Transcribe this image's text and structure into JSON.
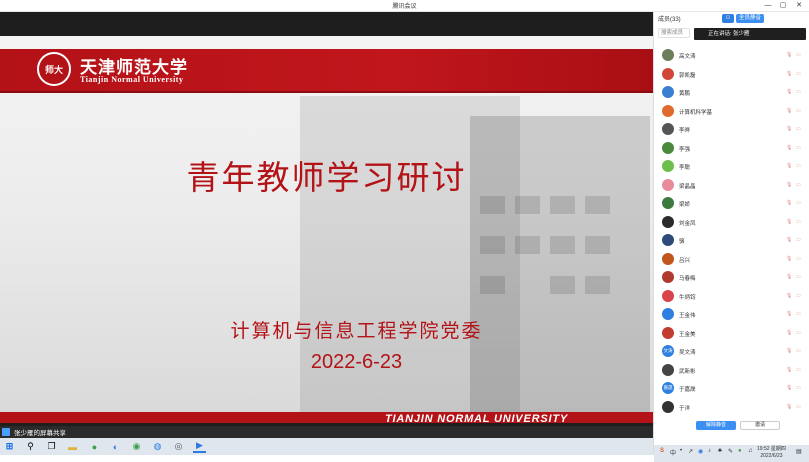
{
  "window": {
    "title": "腾讯会议"
  },
  "slide": {
    "logo_cn": "天津师范大学",
    "logo_en": "Tianjin Normal University",
    "seal": "师大",
    "title": "青年教师学习研讨",
    "subtitle": "计算机与信息工程学院党委",
    "date": "2022-6-23",
    "footer": "TIANJIN NORMAL UNIVERSITY"
  },
  "share_bar": {
    "text": "张少雁的屏幕共享"
  },
  "panel": {
    "header": "成员(33)",
    "btn_invite": "邀请",
    "btn_mute": "全员静音",
    "search_placeholder": "搜索成员",
    "speaking": "正在讲话: 张少雁",
    "members": [
      {
        "name": "高文涛",
        "color": "#6b7d5a"
      },
      {
        "name": "郭凯磊",
        "color": "#d0473a"
      },
      {
        "name": "黄鹏",
        "color": "#3b7fd1"
      },
      {
        "name": "计算机科学基",
        "color": "#e06a2b"
      },
      {
        "name": "李晔",
        "color": "#555555"
      },
      {
        "name": "李强",
        "color": "#4a8a3d"
      },
      {
        "name": "李聪",
        "color": "#6cbf4a"
      },
      {
        "name": "梁晶晶",
        "color": "#e98a9a"
      },
      {
        "name": "梁娇",
        "color": "#3d7a3d"
      },
      {
        "name": "刘金凤",
        "color": "#2b2b2b"
      },
      {
        "name": "骆",
        "color": "#2d4a7a"
      },
      {
        "name": "吕兴",
        "color": "#c0561e"
      },
      {
        "name": "马春梅",
        "color": "#b03a2e"
      },
      {
        "name": "牛炳钧",
        "color": "#d9434a"
      },
      {
        "name": "王金伟",
        "color": "#2f7fe0"
      },
      {
        "name": "王金美",
        "color": "#c23b30"
      },
      {
        "name": "吴文涛",
        "color": "#2f7fe0",
        "initials": "文涛"
      },
      {
        "name": "武新彬",
        "color": "#444444"
      },
      {
        "name": "于嘉晟",
        "color": "#2f7fe0",
        "initials": "嘉晟"
      },
      {
        "name": "于洋",
        "color": "#333333"
      }
    ],
    "footer_btn1": "解除静音",
    "footer_btn2": "邀请"
  },
  "clock": {
    "time": "19:52 星期四",
    "date": "2022/6/23"
  },
  "tray": {
    "ime": "中"
  }
}
